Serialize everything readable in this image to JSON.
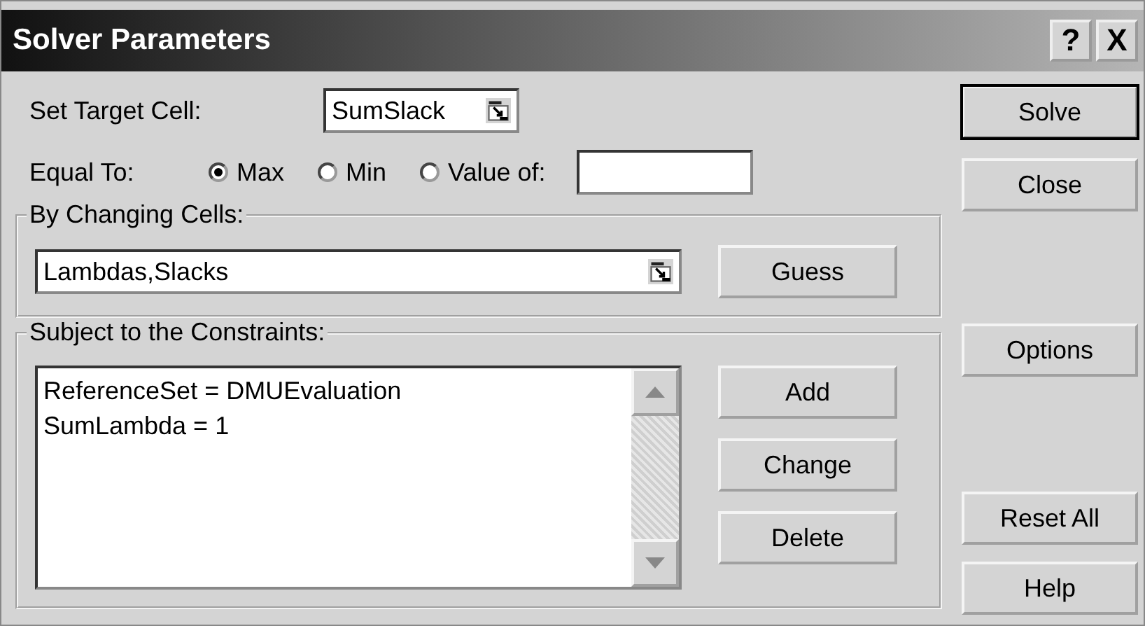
{
  "window": {
    "title": "Solver Parameters",
    "buttons": [
      "?",
      "X"
    ]
  },
  "target": {
    "label": "Set Target Cell:",
    "value": "SumSlack"
  },
  "equal_to": {
    "label": "Equal To:",
    "options": [
      {
        "label": "Max",
        "selected": true
      },
      {
        "label": "Min",
        "selected": false
      },
      {
        "label": "Value of:",
        "selected": false
      }
    ]
  },
  "changing_cells": {
    "title": "By Changing Cells:",
    "value": "Lambdas,Slacks",
    "button": "Guess"
  },
  "constraints": {
    "title": "Subject to the Constraints:",
    "items": [
      "ReferenceSet = DMUEvaluation",
      "SumLambda = 1"
    ],
    "buttons": [
      "Add",
      "Change",
      "Delete"
    ]
  },
  "side_buttons": [
    {
      "label": "Solve",
      "default": true
    },
    {
      "label": "Close",
      "default": false
    },
    {
      "label": "Options",
      "default": false
    },
    {
      "label": "Reset All",
      "default": false
    },
    {
      "label": "Help",
      "default": false
    }
  ]
}
